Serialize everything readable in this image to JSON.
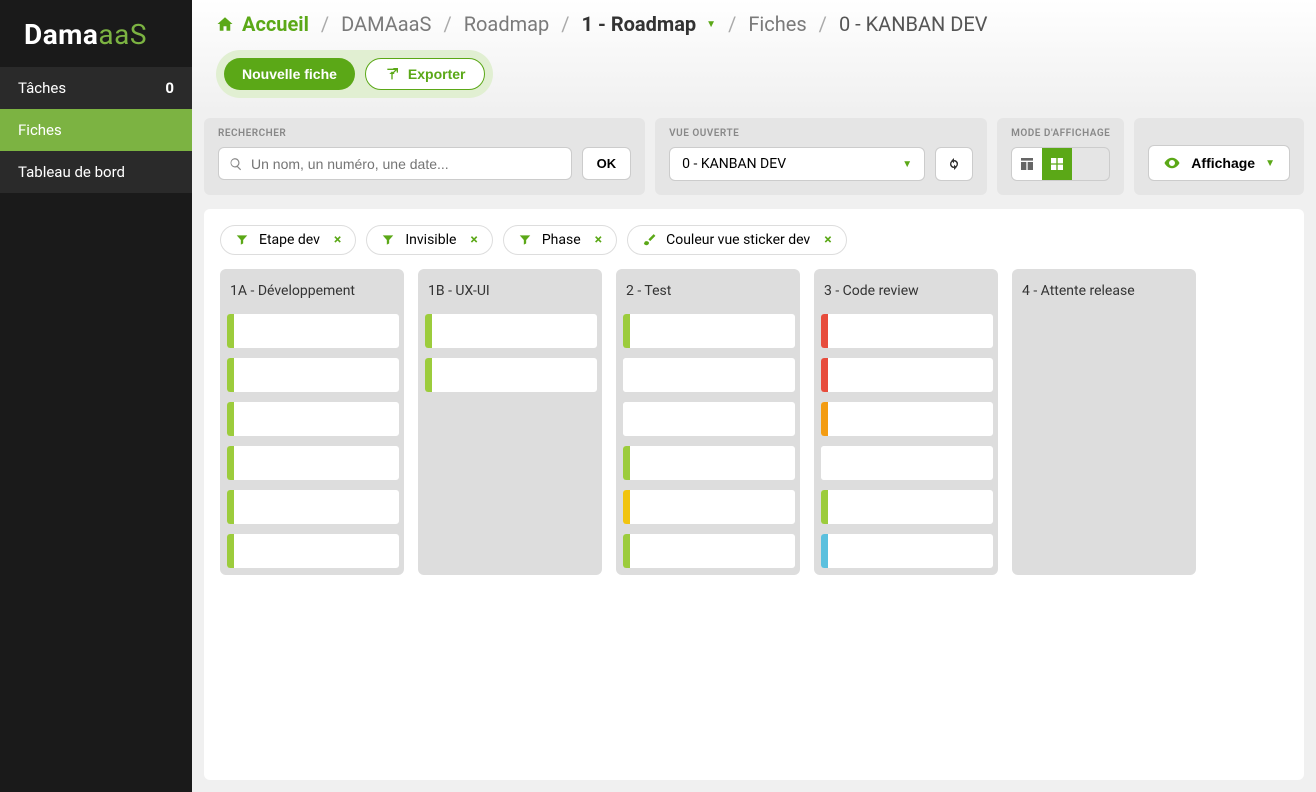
{
  "logo": {
    "prefix": "Dama",
    "suffix": "aaS"
  },
  "sidebar": {
    "items": [
      {
        "label": "Tâches",
        "count": "0",
        "active": false,
        "dark": true
      },
      {
        "label": "Fiches",
        "count": "",
        "active": true,
        "dark": false
      },
      {
        "label": "Tableau de bord",
        "count": "",
        "active": false,
        "dark": true
      }
    ]
  },
  "breadcrumb": {
    "home": "Accueil",
    "b1": "DAMAaaS",
    "b2": "Roadmap",
    "b3": "1 - Roadmap",
    "b4": "Fiches",
    "b5": "0 - KANBAN DEV"
  },
  "actions": {
    "new": "Nouvelle fiche",
    "export": "Exporter"
  },
  "panels": {
    "search_label": "RECHERCHER",
    "search_placeholder": "Un nom, un numéro, une date...",
    "ok": "OK",
    "view_label": "VUE OUVERTE",
    "view_value": "0 - KANBAN DEV",
    "mode_label": "MODE D'AFFICHAGE",
    "display": "Affichage"
  },
  "filters": [
    {
      "label": "Etape dev",
      "icon": "funnel"
    },
    {
      "label": "Invisible",
      "icon": "funnel"
    },
    {
      "label": "Phase",
      "icon": "funnel"
    },
    {
      "label": "Couleur vue sticker dev",
      "icon": "brush"
    }
  ],
  "columns": [
    {
      "title": "1A - Développement",
      "cards": [
        {
          "c": "#9ccc3c"
        },
        {
          "c": "#9ccc3c"
        },
        {
          "c": "#9ccc3c"
        },
        {
          "c": "#9ccc3c"
        },
        {
          "c": "#9ccc3c"
        },
        {
          "c": "#9ccc3c"
        },
        {
          "c": "#9ccc3c"
        }
      ]
    },
    {
      "title": "1B - UX-UI",
      "cards": [
        {
          "c": "#9ccc3c"
        },
        {
          "c": "#9ccc3c"
        }
      ]
    },
    {
      "title": "2 - Test",
      "cards": [
        {
          "c": "#9ccc3c"
        },
        {
          "c": "#ffffff"
        },
        {
          "c": "#ffffff"
        },
        {
          "c": "#9ccc3c"
        },
        {
          "c": "#f1c40f"
        },
        {
          "c": "#9ccc3c"
        }
      ]
    },
    {
      "title": "3 - Code review",
      "cards": [
        {
          "c": "#e74c3c"
        },
        {
          "c": "#e74c3c"
        },
        {
          "c": "#f39c12"
        },
        {
          "c": "#ffffff"
        },
        {
          "c": "#9ccc3c"
        },
        {
          "c": "#5bc0de"
        }
      ]
    },
    {
      "title": "4 - Attente release",
      "cards": []
    }
  ]
}
